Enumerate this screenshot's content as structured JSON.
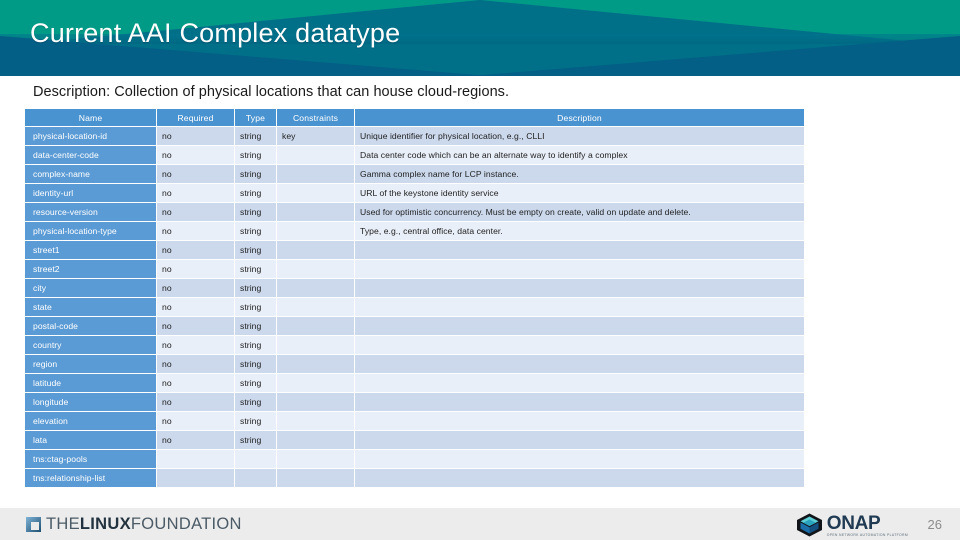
{
  "header": {
    "title": "Current AAI Complex datatype"
  },
  "description_line": "Description: Collection of physical locations that can house cloud-regions.",
  "table": {
    "columns": [
      "Name",
      "Required",
      "Type",
      "Constraints",
      "Description"
    ],
    "rows": [
      {
        "name": "physical-location-id",
        "required": "no",
        "type": "string",
        "constraints": "key",
        "description": "Unique identifier for physical location, e.g., CLLI"
      },
      {
        "name": "data-center-code",
        "required": "no",
        "type": "string",
        "constraints": "",
        "description": "Data center code which can be an alternate way to identify a complex"
      },
      {
        "name": "complex-name",
        "required": "no",
        "type": "string",
        "constraints": "",
        "description": "Gamma complex name for LCP instance."
      },
      {
        "name": "identity-url",
        "required": "no",
        "type": "string",
        "constraints": "",
        "description": "URL of the keystone identity service"
      },
      {
        "name": "resource-version",
        "required": "no",
        "type": "string",
        "constraints": "",
        "description": "Used for optimistic concurrency.  Must be empty on create, valid on update and delete."
      },
      {
        "name": "physical-location-type",
        "required": "no",
        "type": "string",
        "constraints": "",
        "description": "Type, e.g., central office, data center."
      },
      {
        "name": "street1",
        "required": "no",
        "type": "string",
        "constraints": "",
        "description": ""
      },
      {
        "name": "street2",
        "required": "no",
        "type": "string",
        "constraints": "",
        "description": ""
      },
      {
        "name": "city",
        "required": "no",
        "type": "string",
        "constraints": "",
        "description": ""
      },
      {
        "name": "state",
        "required": "no",
        "type": "string",
        "constraints": "",
        "description": ""
      },
      {
        "name": "postal-code",
        "required": "no",
        "type": "string",
        "constraints": "",
        "description": ""
      },
      {
        "name": "country",
        "required": "no",
        "type": "string",
        "constraints": "",
        "description": ""
      },
      {
        "name": "region",
        "required": "no",
        "type": "string",
        "constraints": "",
        "description": ""
      },
      {
        "name": "latitude",
        "required": "no",
        "type": "string",
        "constraints": "",
        "description": ""
      },
      {
        "name": "longitude",
        "required": "no",
        "type": "string",
        "constraints": "",
        "description": ""
      },
      {
        "name": "elevation",
        "required": "no",
        "type": "string",
        "constraints": "",
        "description": ""
      },
      {
        "name": "lata",
        "required": "no",
        "type": "string",
        "constraints": "",
        "description": ""
      },
      {
        "name": "tns:ctag-pools",
        "required": "",
        "type": "",
        "constraints": "",
        "description": ""
      },
      {
        "name": "tns:relationship-list",
        "required": "",
        "type": "",
        "constraints": "",
        "description": ""
      }
    ]
  },
  "footer": {
    "linux_foundation": {
      "the": "THE",
      "linux": "LINUX",
      "foundation": "FOUNDATION"
    },
    "onap": {
      "name": "ONAP",
      "tagline": "OPEN NETWORK AUTOMATION PLATFORM"
    },
    "page_number": "26"
  },
  "colors": {
    "banner_teal": "#009b87",
    "banner_blue": "#007089",
    "banner_dark": "#035f86",
    "table_header": "#4a93d1",
    "name_cell": "#5b9bd5",
    "row_odd": "#ccd9ec",
    "row_even": "#e9eff8",
    "footer_bg": "#ececec"
  }
}
